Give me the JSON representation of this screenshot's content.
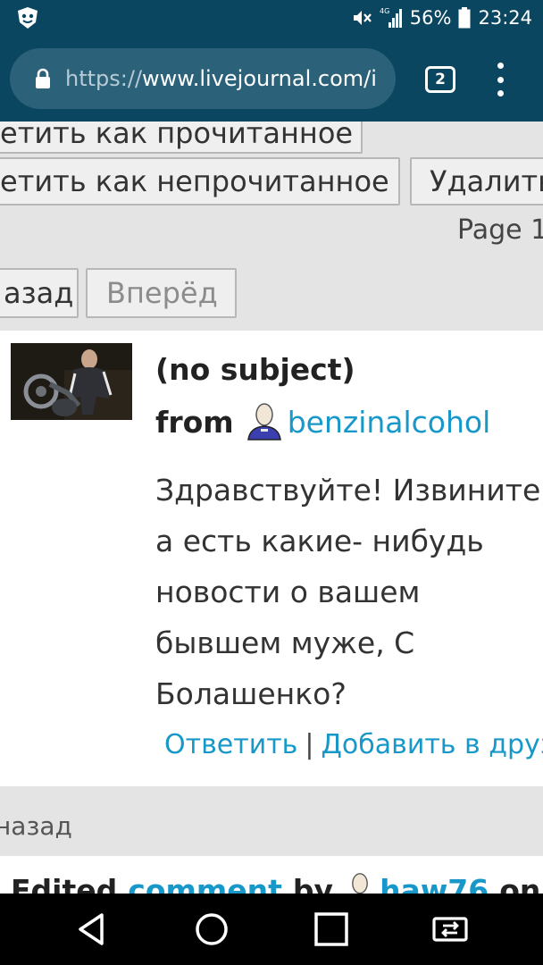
{
  "status": {
    "battery_percent": "56%",
    "time": "23:24",
    "network": "4G"
  },
  "browser": {
    "url_scheme": "https://",
    "url_rest": "www.livejournal.com/i",
    "tab_count": "2"
  },
  "toolbar": {
    "mark_read_label": "етить как прочитанное",
    "mark_unread_label": "етить как непрочитанное",
    "delete_label": "Удалить",
    "page_label": "Page 1",
    "back_label": "азад",
    "forward_label": "Вперёд"
  },
  "message": {
    "subject": "(no subject)",
    "from_label": "from",
    "username": "benzinalcohol",
    "body_lines": [
      "Здравствуйте! Извините,",
      "а есть какие- нибудь",
      "новости о вашем",
      "бывшем муже, С",
      "Болашенко?"
    ],
    "reply_label": "Ответить",
    "separator": "|",
    "add_friend_label": "Добавить в друзья"
  },
  "footer": {
    "back_small": "назад",
    "edited_prefix": "Edited",
    "edited_link": "comment",
    "edited_by": "by",
    "edited_user": "haw76",
    "edited_suffix": "on"
  },
  "colors": {
    "chrome": "#0a4660",
    "link": "#1798c9"
  },
  "icons": [
    "app-icon",
    "mute-icon",
    "signal-icon",
    "battery-icon",
    "lock-icon",
    "tabs-icon",
    "overflow-menu-icon",
    "user-icon",
    "back-nav-icon",
    "home-nav-icon",
    "recents-nav-icon",
    "screen-share-icon"
  ]
}
